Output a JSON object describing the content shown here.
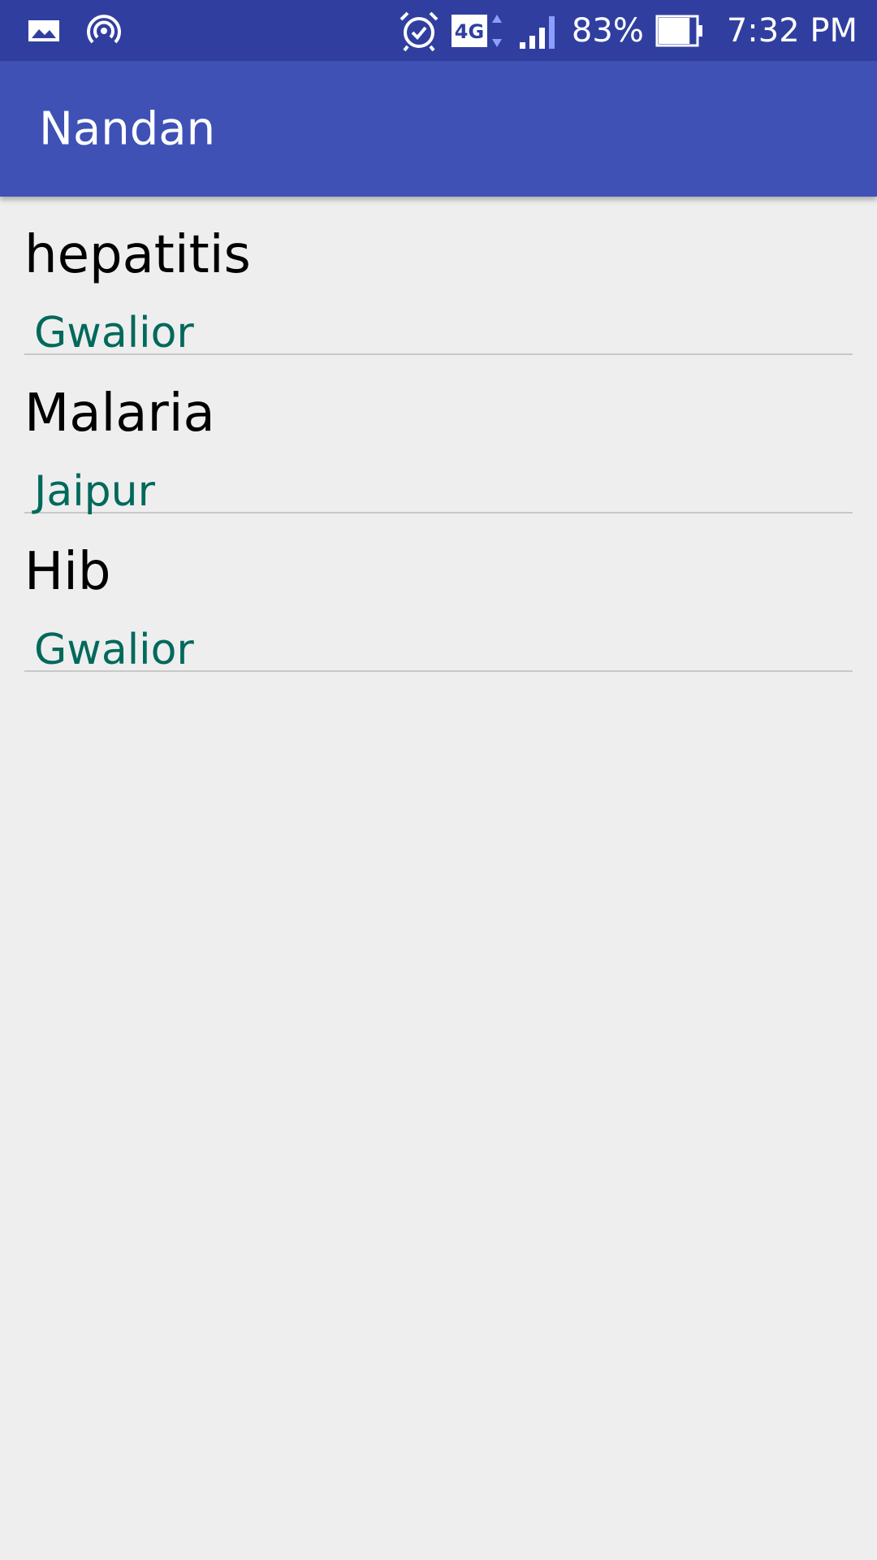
{
  "status_bar": {
    "left_icons": [
      "gallery-icon",
      "hotspot-icon"
    ],
    "right_icons": [
      "alarm-icon",
      "network-4g-icon",
      "signal-icon"
    ],
    "network_label": "4G",
    "battery_percent": "83%",
    "battery_level": 0.83,
    "time": "7:32 PM"
  },
  "app_bar": {
    "title": "Nandan",
    "color": "#3f51b5"
  },
  "list": {
    "items": [
      {
        "title": "hepatitis",
        "subtitle": "Gwalior"
      },
      {
        "title": "Malaria",
        "subtitle": "Jaipur"
      },
      {
        "title": "Hib",
        "subtitle": "Gwalior"
      }
    ]
  },
  "colors": {
    "status_bar": "#303f9f",
    "background": "#eeeeee",
    "subtitle_text": "#00695c",
    "divider": "#c8c8c8"
  }
}
